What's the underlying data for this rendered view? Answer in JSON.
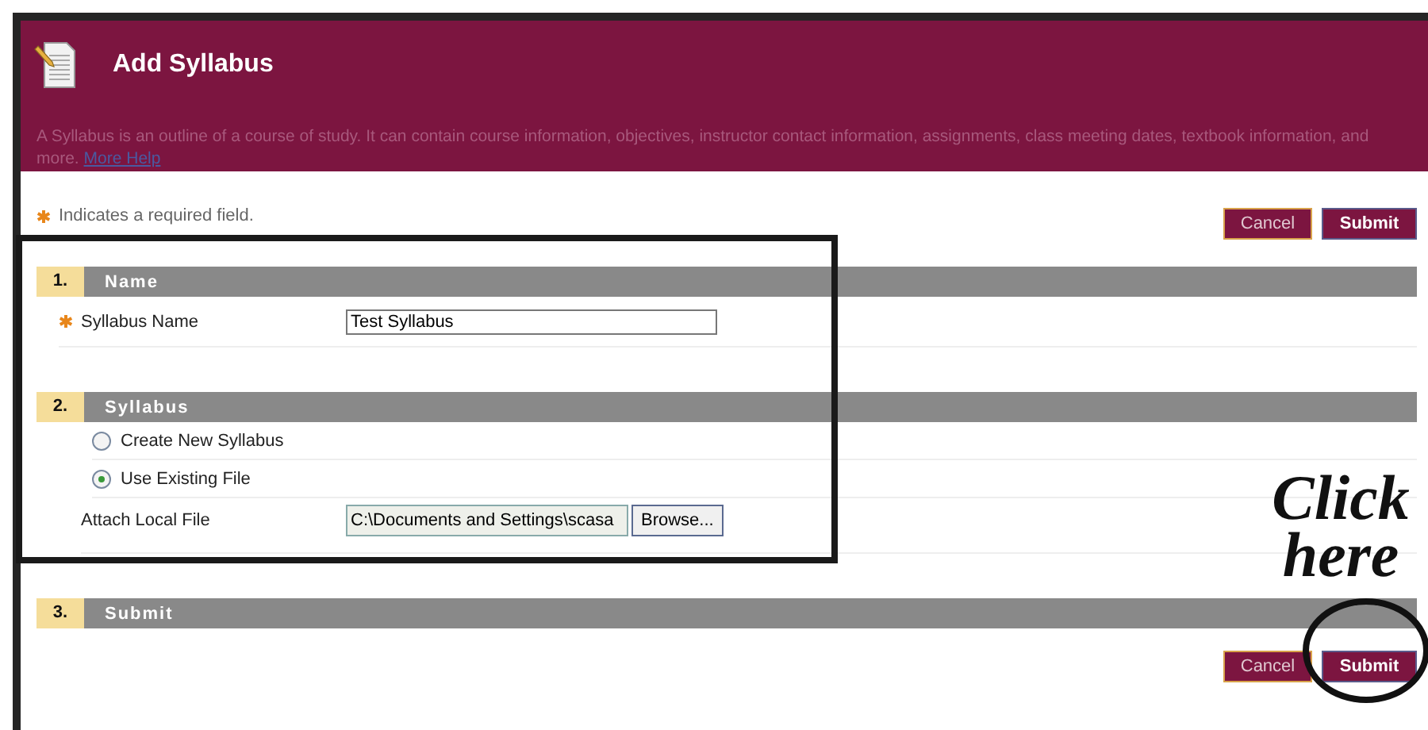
{
  "page": {
    "title": "Add Syllabus",
    "description": "A Syllabus is an outline of a course of study. It can contain course information, objectives, instructor contact information, assignments, class meeting dates, textbook information, and more.",
    "help_link": "More Help"
  },
  "required_note": "Indicates a required field.",
  "top_buttons": [
    {
      "label": "Cancel",
      "kind": "cancel"
    },
    {
      "label": "Submit",
      "kind": "submit"
    }
  ],
  "sections": [
    {
      "number": "1.",
      "title": "Name",
      "fields": [
        {
          "kind": "text",
          "label": "Syllabus Name",
          "required": true,
          "value": "Test Syllabus"
        }
      ]
    },
    {
      "number": "2.",
      "title": "Syllabus",
      "fields": [
        {
          "kind": "radio",
          "label": "Create New Syllabus",
          "selected": false
        },
        {
          "kind": "radio",
          "label": "Use Existing File",
          "selected": true
        },
        {
          "kind": "file",
          "label": "Attach Local File",
          "value": "C:\\Documents and Settings\\scasa",
          "button": "Browse..."
        }
      ]
    },
    {
      "number": "3.",
      "title": "Submit"
    }
  ],
  "bottom_buttons": [
    {
      "label": "Cancel",
      "kind": "cancel"
    },
    {
      "label": "Submit",
      "kind": "submit"
    }
  ],
  "annotation": {
    "lines": [
      "Click",
      "here"
    ]
  }
}
